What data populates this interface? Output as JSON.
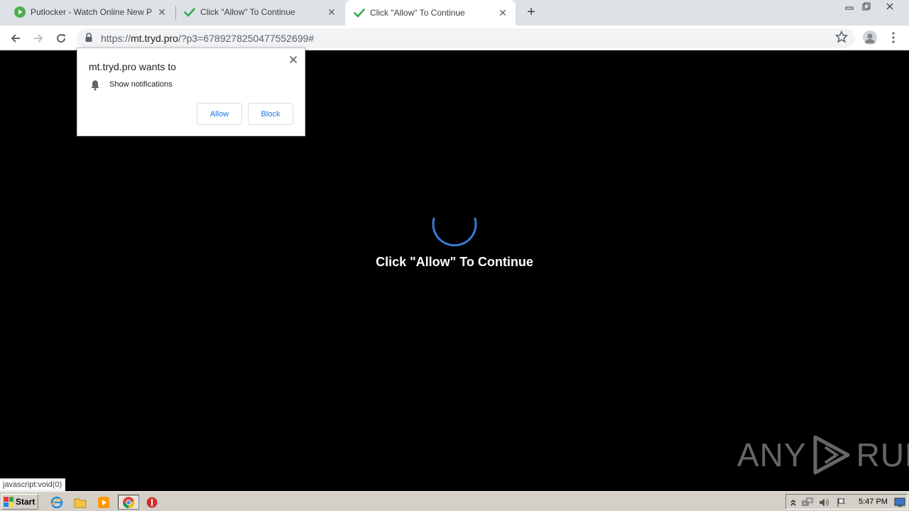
{
  "browser": {
    "tabs": [
      {
        "title": "Putlocker - Watch Online New Putlocker",
        "favicon": "play-circle-icon"
      },
      {
        "title": "Click \"Allow\" To Continue",
        "favicon": "checkmark-icon"
      },
      {
        "title": "Click \"Allow\" To Continue",
        "favicon": "checkmark-icon",
        "active": true
      }
    ],
    "url_scheme": "https://",
    "url_host": "mt.tryd.pro",
    "url_path": "/?p3=6789278250477552699#"
  },
  "permission_popup": {
    "origin_text": "mt.tryd.pro wants to",
    "request_text": "Show notifications",
    "allow_label": "Allow",
    "block_label": "Block"
  },
  "page": {
    "message": "Click \"Allow\" To Continue",
    "status_text": "javascript:void(0)",
    "watermark": "ANY RUN"
  },
  "taskbar": {
    "start_label": "Start",
    "clock": "5:47 PM"
  },
  "colors": {
    "spinner": "#3a7bd5",
    "tab_check": "#34a853",
    "link_blue": "#1a73e8"
  }
}
